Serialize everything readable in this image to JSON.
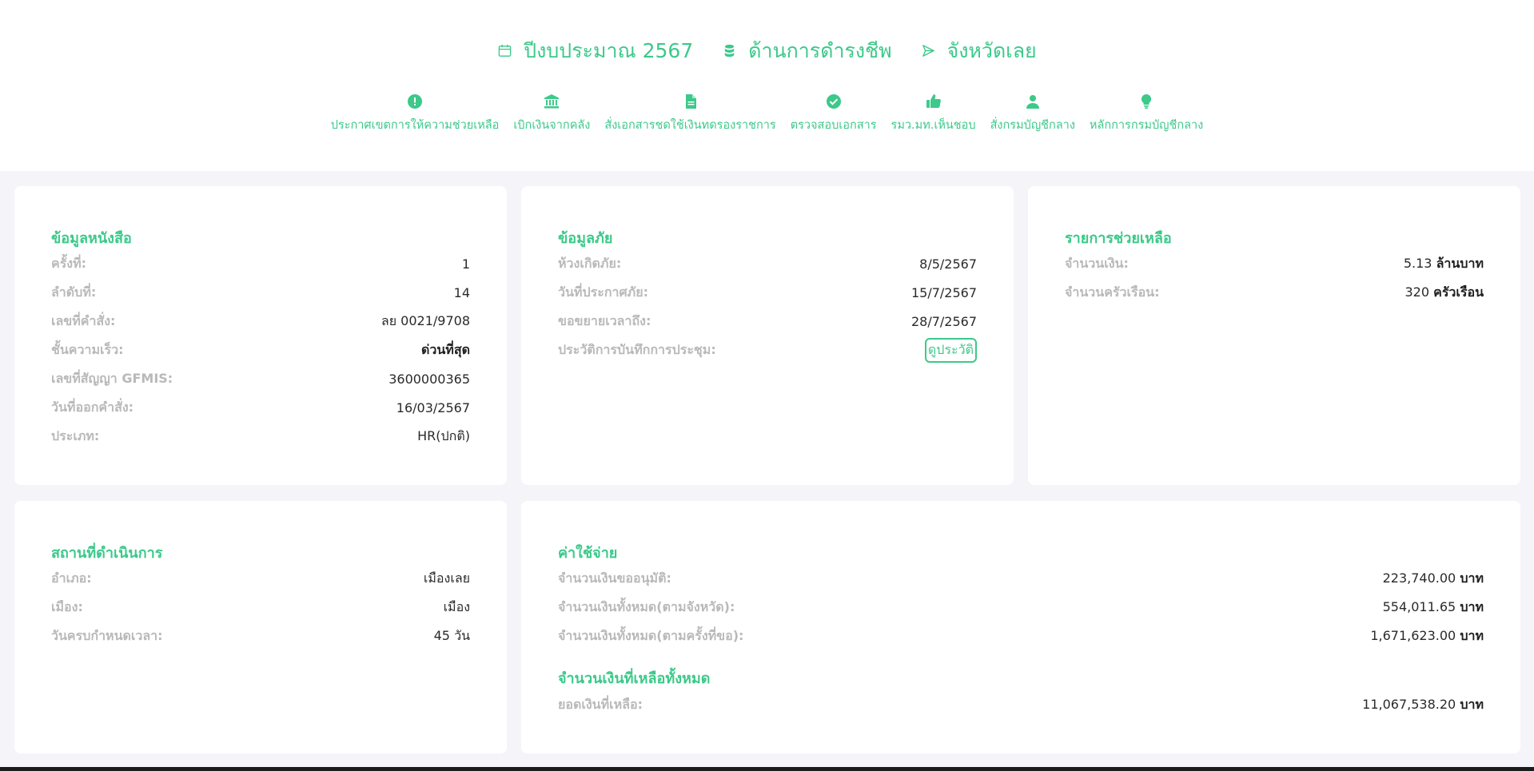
{
  "header": {
    "budget_year": "ปีงบประมาณ 2567",
    "category": "ด้านการดำรงชีพ",
    "province": "จังหวัดเลย",
    "nav": [
      {
        "label": "ประกาศเขตการให้ความช่วยเหลือ",
        "icon": "alert-circle-icon"
      },
      {
        "label": "เบิกเงินจากคลัง",
        "icon": "bank-icon"
      },
      {
        "label": "สั่งเอกสารชดใช้เงินทดรองราชการ",
        "icon": "document-icon"
      },
      {
        "label": "ตรวจสอบเอกสาร",
        "icon": "check-circle-icon"
      },
      {
        "label": "รมว.มท.เห็นชอบ",
        "icon": "thumbs-up-icon"
      },
      {
        "label": "สั่งกรมบัญชีกลาง",
        "icon": "user-icon"
      },
      {
        "label": "หลักการกรมบัญชีกลาง",
        "icon": "lightbulb-icon"
      }
    ]
  },
  "book_info": {
    "title": "ข้อมูลหนังสือ",
    "rows": [
      {
        "label": "ครั้งที่:",
        "value": "1"
      },
      {
        "label": "ลำดับที่:",
        "value": "14"
      },
      {
        "label": "เลขที่คำสั่ง:",
        "value": "ลย 0021/9708"
      },
      {
        "label": "ชั้นความเร็ว:",
        "value": "ด่วนที่สุด"
      },
      {
        "label": "เลขที่สัญญา GFMIS:",
        "value": "3600000365"
      },
      {
        "label": "วันที่ออกคำสั่ง:",
        "value": "16/03/2567"
      },
      {
        "label": "ประเภท:",
        "value": "HR(ปกติ)"
      }
    ]
  },
  "disaster_info": {
    "title": "ข้อมูลภัย",
    "rows": [
      {
        "label": "ห้วงเกิดภัย:",
        "value": "8/5/2567"
      },
      {
        "label": "วันที่ประกาศภัย:",
        "value": "15/7/2567"
      },
      {
        "label": "ขอขยายเวลาถึง:",
        "value": "28/7/2567"
      }
    ],
    "meeting_label": "ประวัติการบันทึกการประชุม:",
    "history_button": "ดูประวัติ"
  },
  "aid_list": {
    "title": "รายการช่วยเหลือ",
    "amount_label": "จำนวนเงิน:",
    "amount_value": "5.13",
    "amount_unit": "ล้านบาท",
    "households_label": "จำนวนครัวเรือน:",
    "households_value": "320",
    "households_unit": "ครัวเรือน"
  },
  "location": {
    "title": "สถานที่ดำเนินการ",
    "rows": [
      {
        "label": "อำเภอ:",
        "value": "เมืองเลย"
      },
      {
        "label": "เมือง:",
        "value": "เมือง"
      }
    ],
    "deadline_label": "วันครบกำหนดเวลา:",
    "deadline_value": "45",
    "deadline_unit": "วัน"
  },
  "expenses": {
    "title": "ค่าใช้จ่าย",
    "rows": [
      {
        "label": "จำนวนเงินขออนุมัติ:",
        "value": "223,740.00",
        "unit": "บาท"
      },
      {
        "label": "จำนวนเงินทั้งหมด(ตามจังหวัด):",
        "value": "554,011.65",
        "unit": "บาท"
      },
      {
        "label": "จำนวนเงินทั้งหมด(ตามครั้งที่ขอ):",
        "value": "1,671,623.00",
        "unit": "บาท"
      }
    ],
    "remaining_title": "จำนวนเงินที่เหลือทั้งหมด",
    "remaining_label": "ยอดเงินที่เหลือ:",
    "remaining_value": "11,067,538.20",
    "remaining_unit": "บาท"
  },
  "colors": {
    "accent": "#3cc98a",
    "label": "#b9b9b9",
    "background": "#f5f5f9"
  }
}
